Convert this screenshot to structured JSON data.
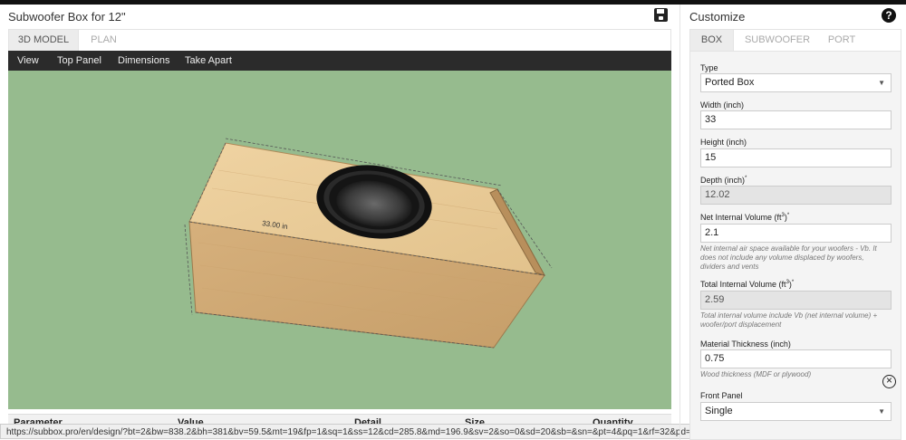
{
  "header": {
    "title": "Subwoofer Box for 12\""
  },
  "view_tabs": [
    {
      "label": "3D MODEL"
    },
    {
      "label": "PLAN"
    }
  ],
  "menu": [
    {
      "label": "View"
    },
    {
      "label": "Top Panel"
    },
    {
      "label": "Dimensions"
    },
    {
      "label": "Take Apart"
    }
  ],
  "model": {
    "width_label": "33.00 in"
  },
  "table": {
    "headers": [
      "Parameter",
      "Value",
      "Detail",
      "Size",
      "Quantity"
    ]
  },
  "status": {
    "url": "https://subbox.pro/en/design/?bt=2&bw=838.2&bh=381&bv=59.5&mt=19&fp=1&sq=1&ss=12&cd=285.8&md=196.9&sv=2&so=0&sd=20&sb=&sn=&pt=4&pq=1&rf=32&pd=140.45&pw=2&pa=154.85&pp=0#model"
  },
  "customize": {
    "title": "Customize",
    "tabs": [
      {
        "label": "BOX"
      },
      {
        "label": "SUBWOOFER"
      },
      {
        "label": "PORT"
      }
    ],
    "fields": {
      "type": {
        "label": "Type",
        "value": "Ported Box"
      },
      "width": {
        "label": "Width (inch)",
        "value": "33"
      },
      "height": {
        "label": "Height (inch)",
        "value": "15"
      },
      "depth": {
        "label": "Depth (inch)",
        "value": "12.02"
      },
      "net_volume": {
        "label": "Net Internal Volume (ft",
        "value": "2.1",
        "help": "Net internal air space available for your woofers - Vb. It does not include any volume displaced by woofers, dividers and vents"
      },
      "total_volume": {
        "label": "Total Internal Volume (ft",
        "value": "2.59",
        "help": "Total internal volume include Vb (net internal volume) + woofer/port displacement"
      },
      "thickness": {
        "label": "Material Thickness (inch)",
        "value": "0.75",
        "help": "Wood thickness (MDF or plywood)"
      },
      "front_panel": {
        "label": "Front Panel",
        "value": "Single"
      }
    }
  }
}
